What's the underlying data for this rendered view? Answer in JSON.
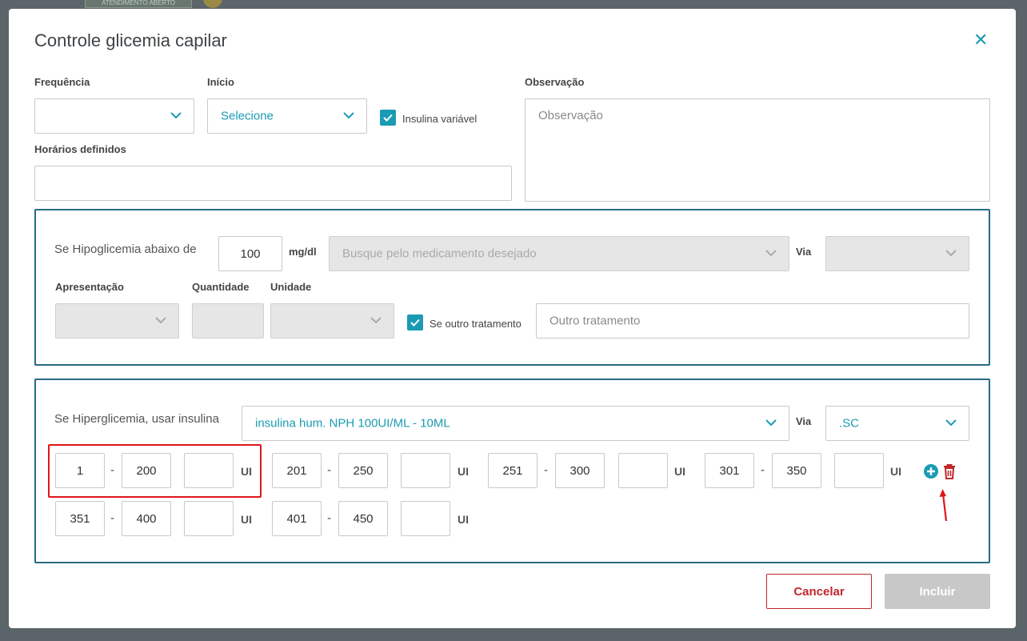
{
  "background": {
    "chip_label": "ATENDIMENTO ABERTO"
  },
  "modal": {
    "title": "Controle glicemia capilar",
    "close_glyph": "✕"
  },
  "form": {
    "frequencia": {
      "label": "Frequência",
      "value": ""
    },
    "inicio": {
      "label": "Início",
      "value": "Selecione"
    },
    "insulina_variavel": {
      "label": "Insulina variável",
      "checked": true
    },
    "horarios": {
      "label": "Horários definidos",
      "value": ""
    },
    "observacao": {
      "label": "Observação",
      "placeholder": "Observação"
    }
  },
  "hipoglicemia": {
    "label": "Se Hipoglicemia abaixo de",
    "value": "100",
    "unit": "mg/dl",
    "medication_placeholder": "Busque pelo medicamento desejado",
    "via_label": "Via",
    "apresentacao_label": "Apresentação",
    "quantidade_label": "Quantidade",
    "unidade_label": "Unidade",
    "outro_checkbox_label": "Se outro tratamento",
    "outro_checked": true,
    "outro_placeholder": "Outro tratamento"
  },
  "hiperglicemia": {
    "label": "Se Hiperglicemia, usar insulina",
    "insulin": "insulina hum. NPH 100UI/ML - 10ML",
    "via_label": "Via",
    "via_value": ".SC",
    "ranges": [
      {
        "from": "1",
        "to": "200",
        "dose": "",
        "unit": "UI"
      },
      {
        "from": "201",
        "to": "250",
        "dose": "",
        "unit": "UI"
      },
      {
        "from": "251",
        "to": "300",
        "dose": "",
        "unit": "UI"
      },
      {
        "from": "301",
        "to": "350",
        "dose": "",
        "unit": "UI"
      },
      {
        "from": "351",
        "to": "400",
        "dose": "",
        "unit": "UI"
      },
      {
        "from": "401",
        "to": "450",
        "dose": "",
        "unit": "UI"
      }
    ],
    "dash": "-"
  },
  "buttons": {
    "cancel": "Cancelar",
    "submit": "Incluir"
  },
  "colors": {
    "accent": "#1a9bb3",
    "section_border": "#276b84",
    "danger": "#c1272d",
    "highlight": "#e0161b"
  }
}
